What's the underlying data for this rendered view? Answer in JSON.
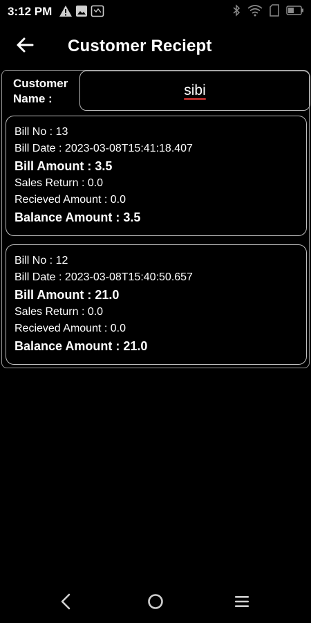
{
  "status_bar": {
    "time": "3:12 PM",
    "left_icons": [
      "warning-icon",
      "image-icon",
      "gallery-icon"
    ],
    "right_icons": [
      "bluetooth-icon",
      "wifi-icon",
      "sim-icon",
      "battery-icon"
    ]
  },
  "app_bar": {
    "back_icon": "arrow-left-icon",
    "title": "Customer Reciept"
  },
  "customer": {
    "label_line1": "Customer",
    "label_line2": "Name :",
    "name": "sibi"
  },
  "bills": [
    {
      "bill_no": "Bill No : 13",
      "bill_date": "Bill Date : 2023-03-08T15:41:18.407",
      "bill_amount": "Bill Amount : 3.5",
      "sales_return": "Sales Return : 0.0",
      "received_amount": "Recieved Amount : 0.0",
      "balance_amount": "Balance Amount : 3.5"
    },
    {
      "bill_no": "Bill No : 12",
      "bill_date": "Bill Date : 2023-03-08T15:40:50.657",
      "bill_amount": "Bill Amount : 21.0",
      "sales_return": "Sales Return : 0.0",
      "received_amount": "Recieved Amount : 0.0",
      "balance_amount": "Balance Amount : 21.0"
    }
  ],
  "nav_bar": {
    "icons": [
      "nav-back-icon",
      "nav-home-icon",
      "nav-menu-icon"
    ]
  },
  "colors": {
    "background": "#000000",
    "text": "#ffffff",
    "border": "#bdbdbd",
    "spellcheck_underline": "#e53935"
  }
}
